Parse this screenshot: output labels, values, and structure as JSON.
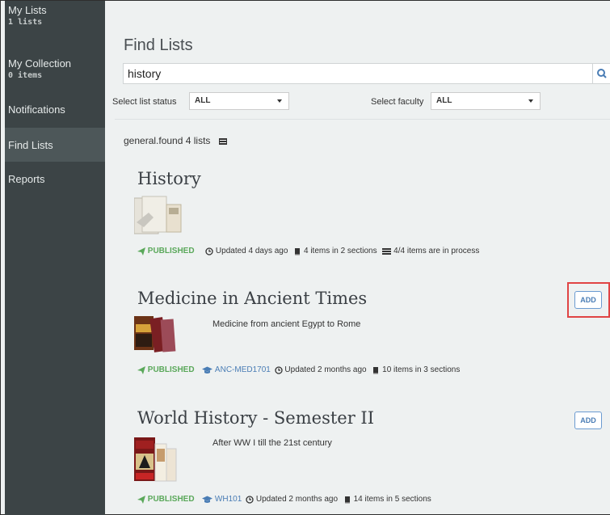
{
  "sidebar": {
    "items": [
      {
        "label": "My Lists",
        "sub": "1 lists"
      },
      {
        "label": "My Collection",
        "sub": "0 items"
      },
      {
        "label": "Notifications"
      },
      {
        "label": "Find Lists"
      },
      {
        "label": "Reports"
      }
    ]
  },
  "page": {
    "title": "Find Lists"
  },
  "search": {
    "value": "history"
  },
  "filters": {
    "status_label": "Select list status",
    "status_value": "ALL",
    "faculty_label": "Select faculty",
    "faculty_value": "ALL"
  },
  "results": {
    "found_text": "general.found 4 lists"
  },
  "lists": [
    {
      "title": "History",
      "status": "PUBLISHED",
      "updated": "Updated 4 days ago",
      "items": "4 items in 2 sections",
      "process": "4/4 items are in process"
    },
    {
      "title": "Medicine in Ancient Times",
      "description": "Medicine from ancient Egypt to Rome",
      "status": "PUBLISHED",
      "code": "ANC-MED1701",
      "updated": "Updated 2 months ago",
      "items": "10 items in 3 sections",
      "add_label": "ADD"
    },
    {
      "title": "World History - Semester II",
      "description": "After WW I till the 21st century",
      "status": "PUBLISHED",
      "code": "WH101",
      "updated": "Updated 2 months ago",
      "items": "14 items in 5 sections",
      "add_label": "ADD"
    }
  ],
  "colors": {
    "sidebar": "#3c4446",
    "published": "#5aa85a",
    "link": "#4a7db5",
    "highlight": "#e04444"
  }
}
